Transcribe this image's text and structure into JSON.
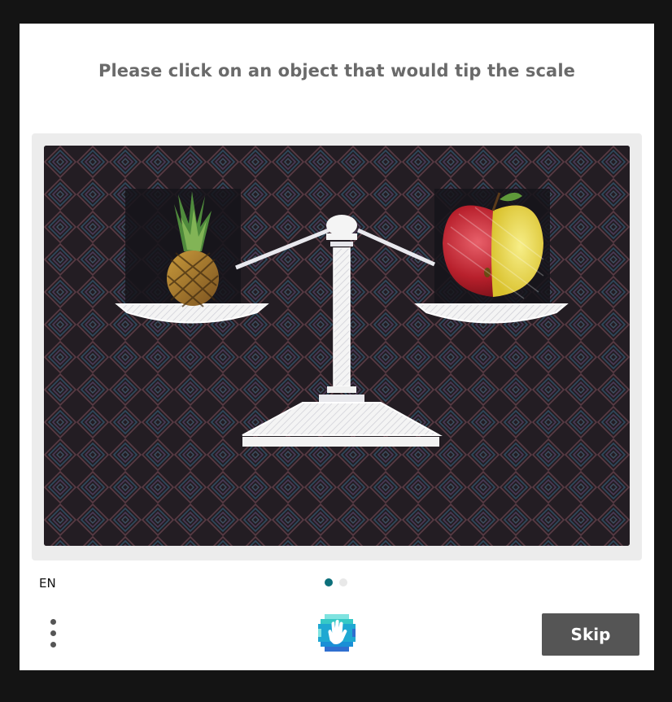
{
  "challenge": {
    "prompt": "Please click on an object that would tip the scale",
    "image": {
      "subject": "balance scale",
      "left_object": "pineapple",
      "right_object": "apple"
    }
  },
  "footer": {
    "language": "EN",
    "pages": [
      {
        "active": true
      },
      {
        "active": false
      }
    ],
    "menu_icon": "kebab-menu-icon",
    "logo_icon": "hand-logo-icon",
    "skip_label": "Skip"
  },
  "colors": {
    "accent": "#0c6f7a",
    "skip_bg": "#555555",
    "prompt_text": "#6a6a6a",
    "logo_blue": "#1a8fd6",
    "logo_teal": "#36c9c6"
  }
}
